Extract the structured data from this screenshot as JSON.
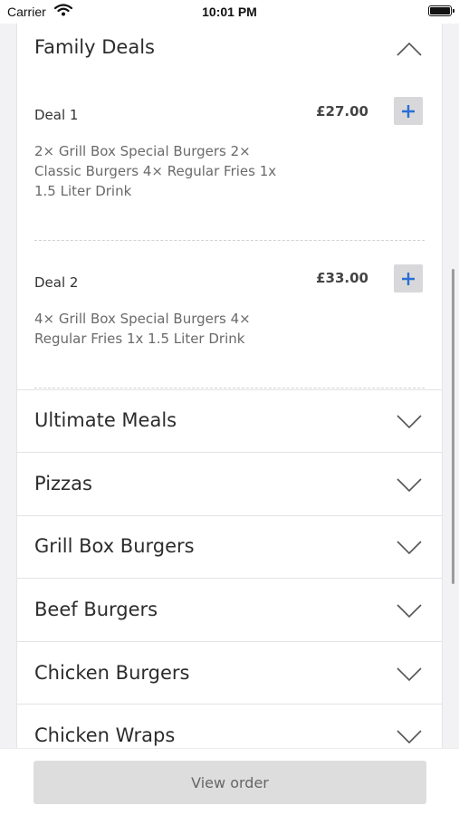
{
  "status_bar": {
    "carrier": "Carrier",
    "time": "10:01 PM"
  },
  "family_deals": {
    "title": "Family Deals",
    "deals": [
      {
        "name": "Deal 1",
        "price": "£27.00",
        "description": "2× Grill Box Special Burgers 2× Classic Burgers 4× Regular Fries 1x 1.5 Liter Drink"
      },
      {
        "name": "Deal 2",
        "price": "£33.00",
        "description": "4× Grill Box Special Burgers 4× Regular Fries 1x 1.5 Liter Drink"
      }
    ]
  },
  "categories": [
    {
      "title": "Ultimate Meals"
    },
    {
      "title": "Pizzas"
    },
    {
      "title": "Grill Box Burgers"
    },
    {
      "title": "Beef Burgers"
    },
    {
      "title": "Chicken Burgers"
    },
    {
      "title": "Chicken Wraps"
    }
  ],
  "footer": {
    "button_label": "View order"
  },
  "colors": {
    "accent": "#2a6fd6",
    "button_bg": "#dddddd",
    "add_button_bg": "#d8d8da"
  }
}
